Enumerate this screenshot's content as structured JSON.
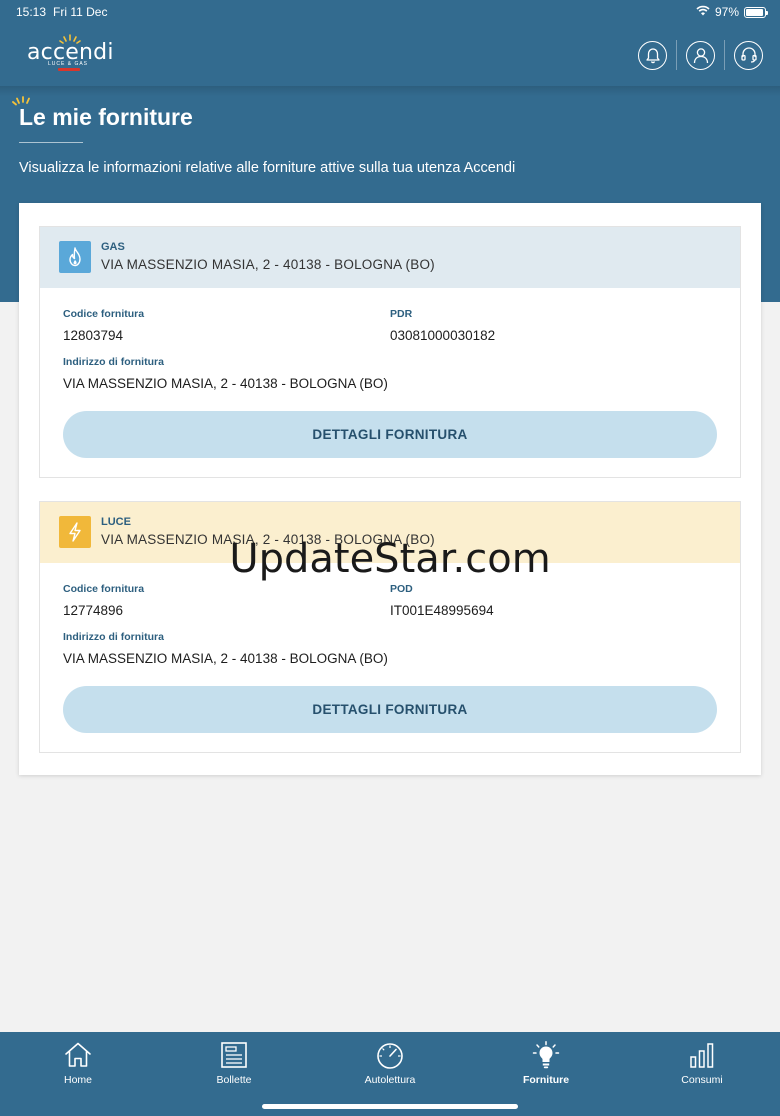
{
  "status_bar": {
    "time": "15:13",
    "date": "Fri 11 Dec",
    "battery": "97%",
    "battery_level": 0.97
  },
  "brand": {
    "logo_text": "accendi",
    "logo_subtext": "LUCE & GAS",
    "primary_color": "#336b8f",
    "accent_color": "#d9362b"
  },
  "header": {
    "icons": [
      "bell-icon",
      "user-icon",
      "headset-icon"
    ]
  },
  "page": {
    "title": "Le mie forniture",
    "subtitle": "Visualizza le informazioni relative alle forniture attive sulla tua utenza Accendi"
  },
  "supplies": [
    {
      "type": "GAS",
      "icon": "flame-icon",
      "address": "VIA MASSENZIO MASIA, 2 - 40138 - BOLOGNA (BO)",
      "code_label": "Codice fornitura",
      "code": "12803794",
      "meter_label": "PDR",
      "meter": "03081000030182",
      "supply_address_label": "Indirizzo di fornitura",
      "supply_address": "VIA MASSENZIO MASIA, 2 - 40138 - BOLOGNA (BO)",
      "button_label": "DETTAGLI FORNITURA"
    },
    {
      "type": "LUCE",
      "icon": "lightning-icon",
      "address": "VIA MASSENZIO MASIA, 2 - 40138 - BOLOGNA (BO)",
      "code_label": "Codice fornitura",
      "code": "12774896",
      "meter_label": "POD",
      "meter": "IT001E48995694",
      "supply_address_label": "Indirizzo di fornitura",
      "supply_address": "VIA MASSENZIO MASIA, 2 - 40138 - BOLOGNA (BO)",
      "button_label": "DETTAGLI FORNITURA"
    }
  ],
  "watermark": "UpdateStar.com",
  "tabbar": {
    "items": [
      {
        "label": "Home",
        "icon": "home-icon",
        "active": false
      },
      {
        "label": "Bollette",
        "icon": "bill-icon",
        "active": false
      },
      {
        "label": "Autolettura",
        "icon": "gauge-icon",
        "active": false
      },
      {
        "label": "Forniture",
        "icon": "lightbulb-icon",
        "active": true
      },
      {
        "label": "Consumi",
        "icon": "bar-chart-icon",
        "active": false
      }
    ]
  }
}
